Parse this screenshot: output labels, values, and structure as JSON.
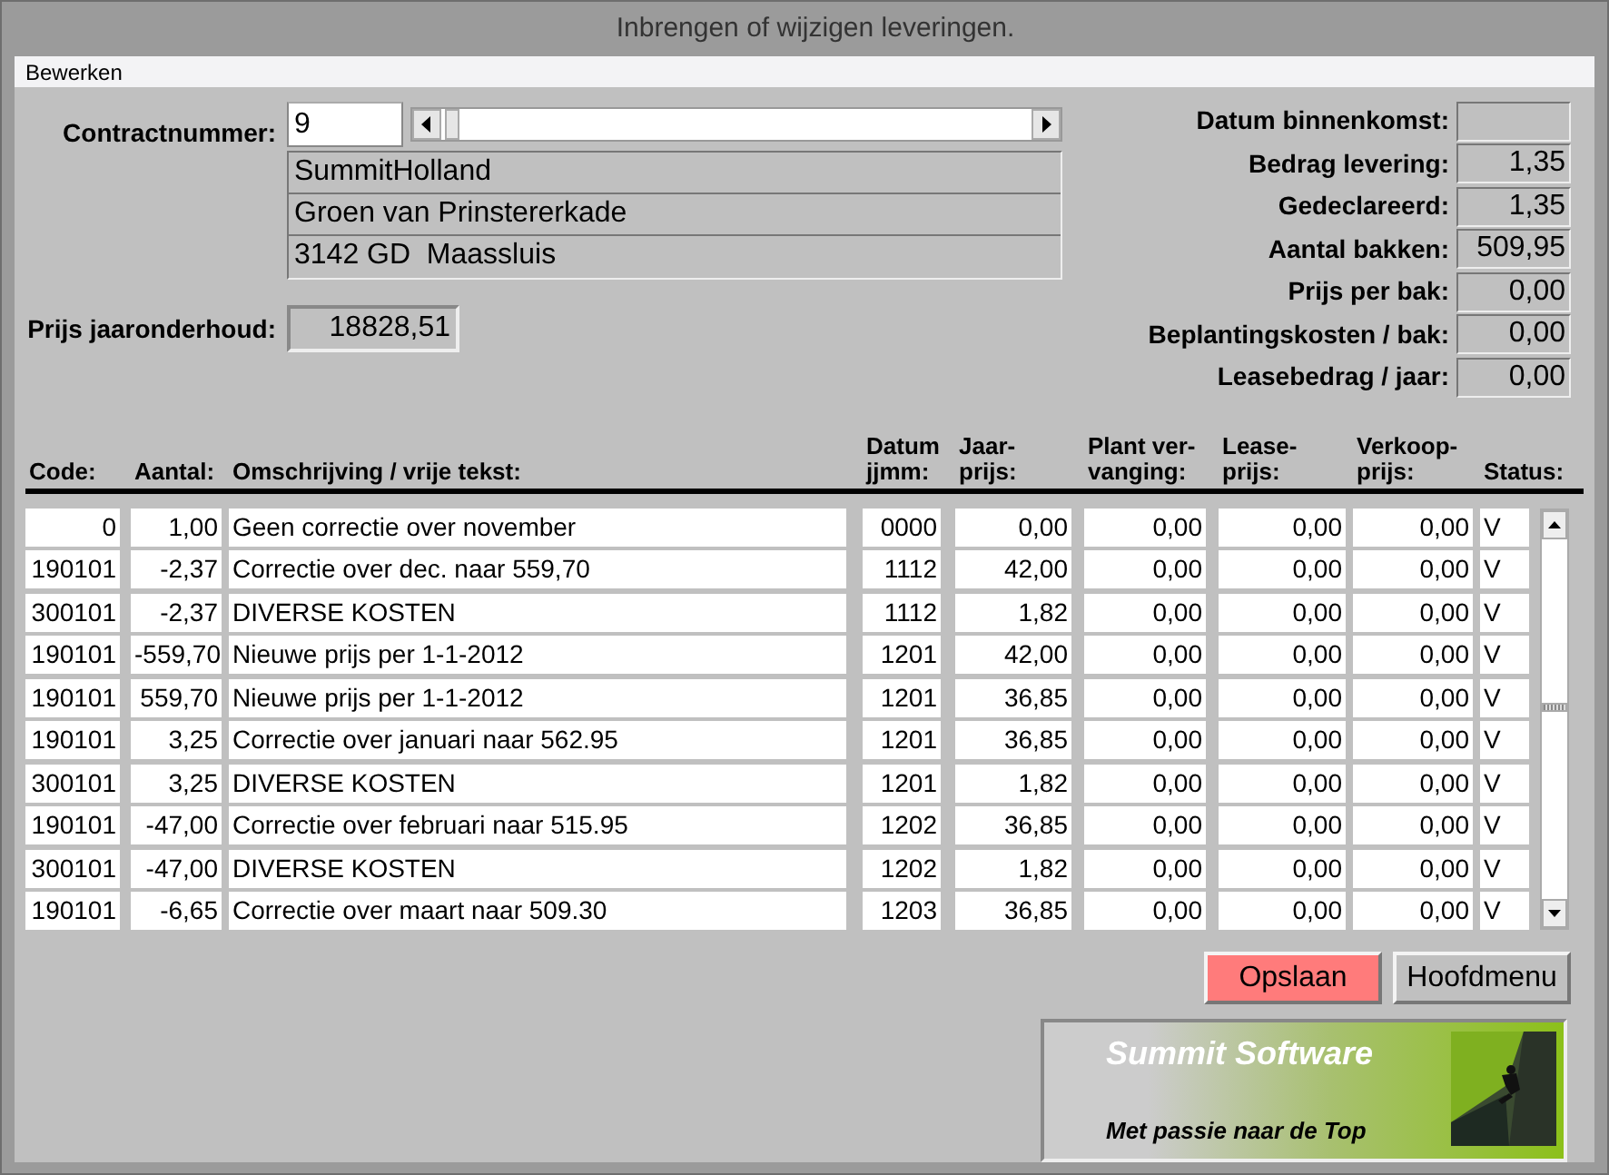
{
  "window": {
    "title": "Inbrengen of wijzigen leveringen."
  },
  "menu": [
    "Bewerken"
  ],
  "contract": {
    "label": "Contractnummer:",
    "value": "9",
    "address": [
      "SummitHolland",
      "Groen van Prinstererkade",
      "3142 GD  Maassluis"
    ]
  },
  "yearly_price": {
    "label": "Prijs jaaronderhoud:",
    "value": "18828,51"
  },
  "summary": [
    {
      "label": "Datum binnenkomst:"
    },
    {
      "label": "Bedrag levering:",
      "value": "1,35"
    },
    {
      "label": "Gedeclareerd:",
      "value": "1,35"
    },
    {
      "label": "Aantal bakken:",
      "value": "509,95"
    },
    {
      "label": "Prijs per bak:",
      "value": "0,00"
    },
    {
      "label": "Beplantingskosten / bak:",
      "value": "0,00"
    },
    {
      "label": "Leasebedrag / jaar:",
      "value": "0,00"
    }
  ],
  "table": {
    "columns": [
      "Code:",
      "Aantal:",
      "Omschrijving / vrije tekst:",
      "Datum\njjmm:",
      "Jaar-\nprijs:",
      "Plant ver-\nvanging:",
      "Lease-\nprijs:",
      "Verkoop-\nprijs:",
      "Status:"
    ],
    "rows": [
      [
        "0",
        "1,00",
        "Geen correctie over november",
        "0000",
        "0,00",
        "0,00",
        "0,00",
        "0,00",
        "V"
      ],
      [
        "190101",
        "-2,37",
        "Correctie over dec. naar 559,70",
        "1112",
        "42,00",
        "0,00",
        "0,00",
        "0,00",
        "V"
      ],
      [
        "300101",
        "-2,37",
        "DIVERSE KOSTEN",
        "1112",
        "1,82",
        "0,00",
        "0,00",
        "0,00",
        "V"
      ],
      [
        "190101",
        "-559,70",
        "Nieuwe prijs per 1-1-2012",
        "1201",
        "42,00",
        "0,00",
        "0,00",
        "0,00",
        "V"
      ],
      [
        "190101",
        "559,70",
        "Nieuwe prijs per 1-1-2012",
        "1201",
        "36,85",
        "0,00",
        "0,00",
        "0,00",
        "V"
      ],
      [
        "190101",
        "3,25",
        "Correctie over januari naar 562.95",
        "1201",
        "36,85",
        "0,00",
        "0,00",
        "0,00",
        "V"
      ],
      [
        "300101",
        "3,25",
        "DIVERSE KOSTEN",
        "1201",
        "1,82",
        "0,00",
        "0,00",
        "0,00",
        "V"
      ],
      [
        "190101",
        "-47,00",
        "Correctie over februari naar 515.95",
        "1202",
        "36,85",
        "0,00",
        "0,00",
        "0,00",
        "V"
      ],
      [
        "300101",
        "-47,00",
        "DIVERSE KOSTEN",
        "1202",
        "1,82",
        "0,00",
        "0,00",
        "0,00",
        "V"
      ],
      [
        "190101",
        "-6,65",
        "Correctie over maart naar 509.30",
        "1203",
        "36,85",
        "0,00",
        "0,00",
        "0,00",
        "V"
      ]
    ]
  },
  "buttons": [
    {
      "label": "Opslaan",
      "kind": "primary"
    },
    {
      "label": "Hoofdmenu",
      "kind": "default"
    }
  ],
  "banner": {
    "title": "Summit Software",
    "slogan": "Met passie naar de Top"
  }
}
